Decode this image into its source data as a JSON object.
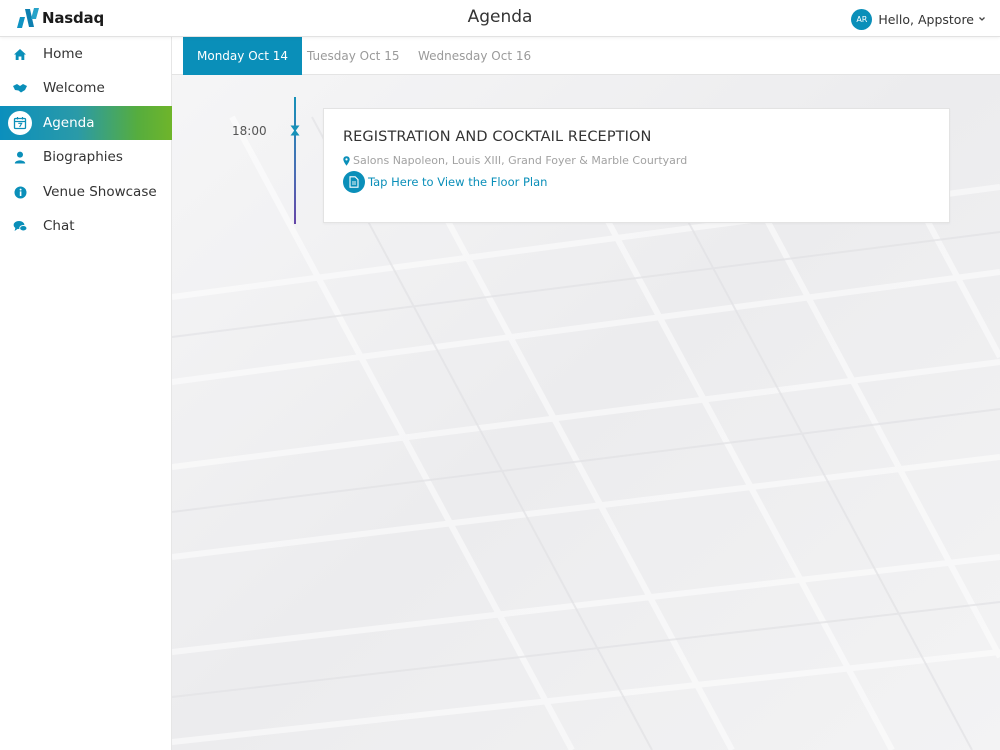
{
  "header": {
    "brand": "Nasdaq",
    "title": "Agenda",
    "user": {
      "initials": "AR",
      "greeting": "Hello, Appstore"
    }
  },
  "sidebar": {
    "items": [
      {
        "label": "Home",
        "icon": "home-icon"
      },
      {
        "label": "Welcome",
        "icon": "handshake-icon"
      },
      {
        "label": "Agenda",
        "icon": "calendar-icon",
        "active": true
      },
      {
        "label": "Biographies",
        "icon": "person-icon"
      },
      {
        "label": "Venue Showcase",
        "icon": "info-icon"
      },
      {
        "label": "Chat",
        "icon": "chat-icon"
      }
    ]
  },
  "tabs": [
    {
      "label": "Monday Oct 14",
      "active": true
    },
    {
      "label": "Tuesday Oct 15"
    },
    {
      "label": "Wednesday Oct 16"
    }
  ],
  "events": [
    {
      "time": "18:00",
      "title": "REGISTRATION AND COCKTAIL RECEPTION",
      "location": "Salons Napoleon, Louis XIII, Grand Foyer & Marble Courtyard",
      "link_label": "Tap Here to View the Floor Plan"
    }
  ],
  "colors": {
    "accent": "#0a8fb9",
    "active_gradient_end": "#6fb52a",
    "timeline_end": "#6546a8"
  }
}
